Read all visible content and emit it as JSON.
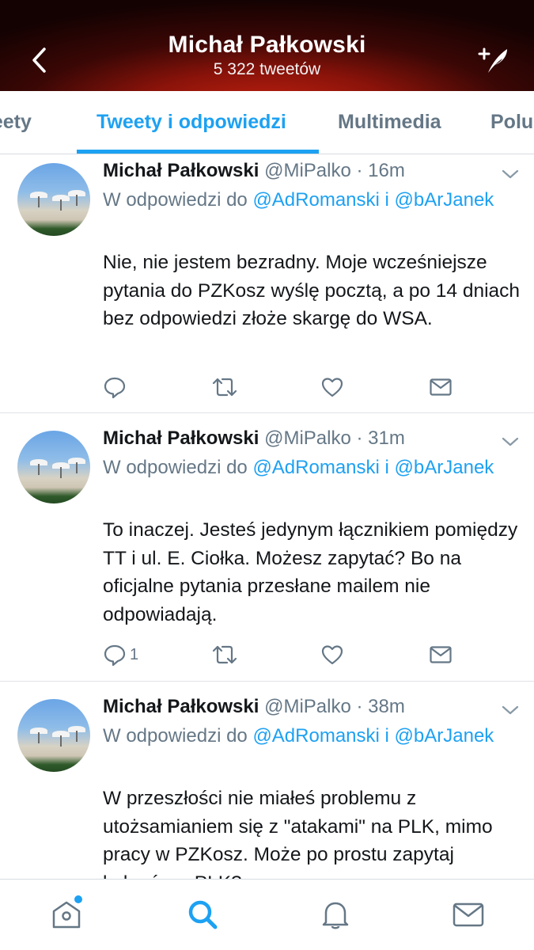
{
  "header": {
    "title": "Michał Pałkowski",
    "subtitle": "5 322 tweetów",
    "back_icon": "chevron-left-icon",
    "compose_icon": "compose-tweet-icon"
  },
  "tabs": [
    {
      "label": "Tweety",
      "active": false
    },
    {
      "label": "Tweety i odpowiedzi",
      "active": true
    },
    {
      "label": "Multimedia",
      "active": false
    },
    {
      "label": "Polubione",
      "active": false
    }
  ],
  "tweets": [
    {
      "name": "Michał Pałkowski",
      "handle": "@MiPalko",
      "time": "16m",
      "reply_prefix": "W odpowiedzi do",
      "mention1": "@AdRomanski",
      "conj": "i",
      "mention2": "@bArJanek",
      "text": "Nie, nie jestem bezradny. Moje wcześniejsze pytania do PZKosz wyślę pocztą, a po 14 dniach bez odpowiedzi złoże skargę do WSA.",
      "reply_count": ""
    },
    {
      "name": "Michał Pałkowski",
      "handle": "@MiPalko",
      "time": "31m",
      "reply_prefix": "W odpowiedzi do",
      "mention1": "@AdRomanski",
      "conj": "i",
      "mention2": "@bArJanek",
      "text": "To inaczej. Jesteś jedynym łącznikiem pomiędzy TT i ul. E. Ciołka. Możesz zapytać? Bo na oficjalne pytania przesłane mailem nie odpowiadają.",
      "reply_count": "1"
    },
    {
      "name": "Michał Pałkowski",
      "handle": "@MiPalko",
      "time": "38m",
      "reply_prefix": "W odpowiedzi do",
      "mention1": "@AdRomanski",
      "conj": "i",
      "mention2": "@bArJanek",
      "text": "W przeszłości nie miałeś problemu z utożsamianiem się z \"atakami\" na PLK, mimo pracy w PZKosz. Może po prostu zapytaj kolegów z PLK?",
      "reply_count": ""
    }
  ],
  "bottom_nav": [
    {
      "icon": "home-icon",
      "notification_dot": true
    },
    {
      "icon": "search-icon",
      "active": true
    },
    {
      "icon": "bell-icon"
    },
    {
      "icon": "mail-icon"
    }
  ],
  "colors": {
    "accent": "#1da1f2",
    "muted": "#657786",
    "text": "#14171a",
    "header_red": "#c2200f"
  }
}
